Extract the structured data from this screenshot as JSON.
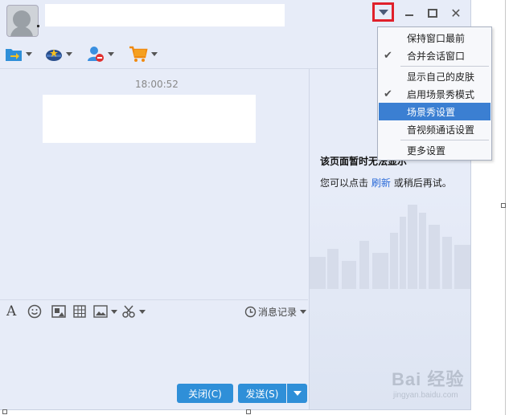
{
  "chat": {
    "timestamp": "18:00:52"
  },
  "toolbar": {
    "items": [
      {
        "icon": "transfer-file-icon"
      },
      {
        "icon": "remote-assist-icon"
      },
      {
        "icon": "block-contact-icon"
      },
      {
        "icon": "shop-cart-icon"
      }
    ]
  },
  "right_panel": {
    "title": "该页面暂时无法显示",
    "msg_prefix": "您可以点击",
    "msg_link": "刷新",
    "msg_suffix": "或稍后再试。"
  },
  "input_toolbar": {
    "font_icon": "A",
    "history_label": "消息记录"
  },
  "buttons": {
    "close_label": "关闭(C)",
    "send_label": "发送(S)"
  },
  "dropdown": {
    "items": [
      {
        "label": "保持窗口最前",
        "checked": false,
        "selected": false
      },
      {
        "label": "合并会话窗口",
        "checked": true,
        "selected": false
      },
      {
        "label": "显示自己的皮肤",
        "checked": false,
        "selected": false
      },
      {
        "label": "启用场景秀模式",
        "checked": true,
        "selected": false
      },
      {
        "label": "场景秀设置",
        "checked": false,
        "selected": true
      },
      {
        "label": "音视频通话设置",
        "checked": false,
        "selected": false
      },
      {
        "label": "更多设置",
        "checked": false,
        "selected": false
      }
    ],
    "check_glyph": "✔"
  },
  "watermark": {
    "main": "Bai  经验",
    "sub": "jingyan.baidu.com"
  },
  "colors": {
    "accent": "#2f8fd8",
    "highlight_border": "#e0202a",
    "selected_item": "#3b7fd2"
  }
}
